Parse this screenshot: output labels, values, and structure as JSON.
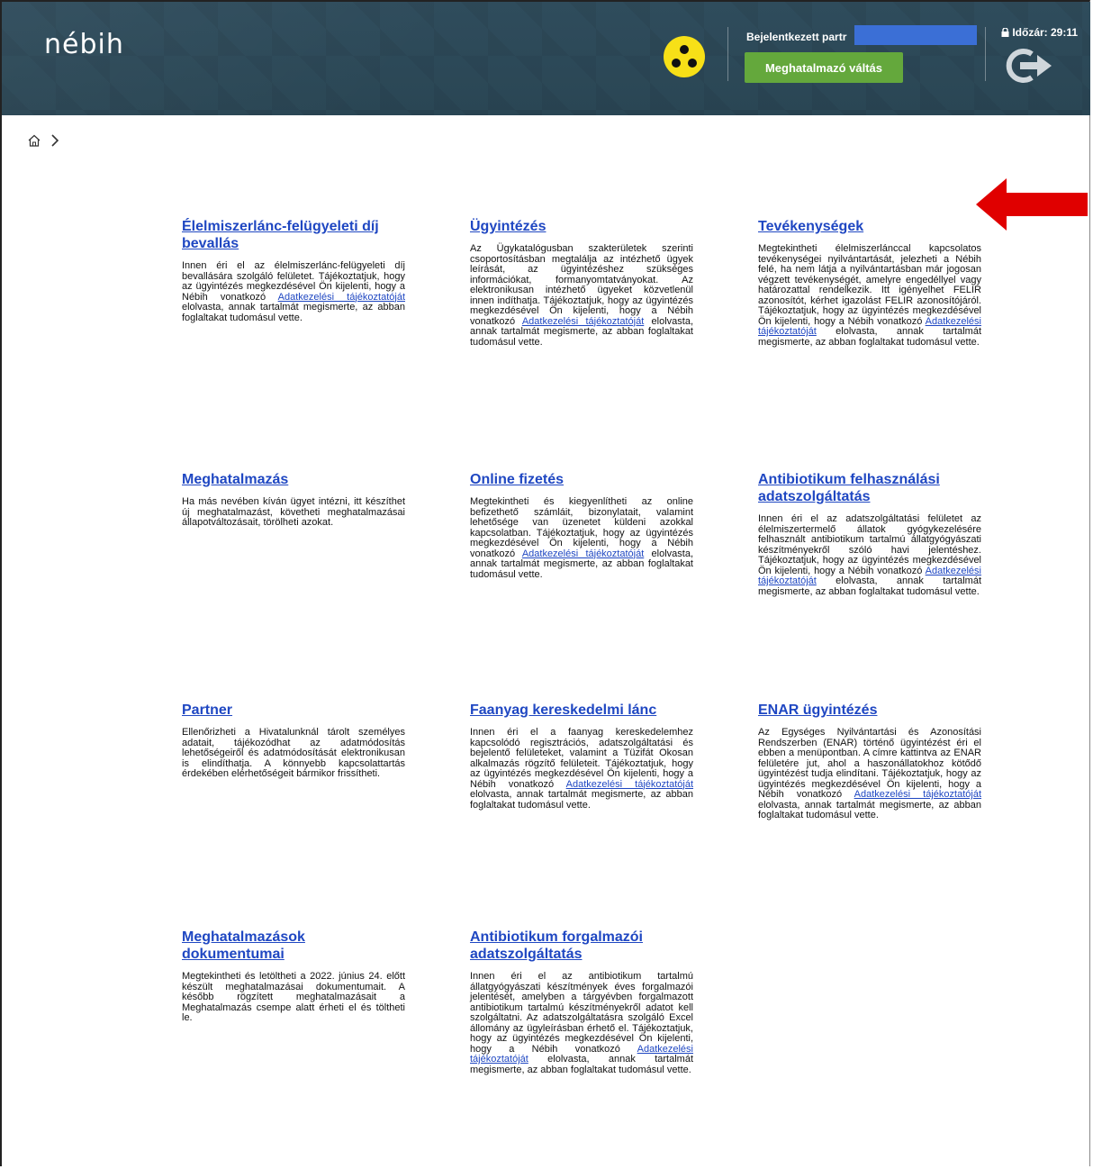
{
  "header": {
    "logo_text": "nébih",
    "logged_in_label": "Bejelentkezett partr",
    "switch_button": "Meghatalmazó váltás",
    "timer": "Időzár: 29:11"
  },
  "colors": {
    "header_bg": "#2f4c5c",
    "link": "#1f47c2",
    "switch_button_bg": "#64a83c",
    "accessibility_icon": "#f7e017",
    "arrow": "#e00000"
  },
  "icons": {
    "accessibility": "low-vision-icon",
    "logout": "logout-icon",
    "home": "home-icon",
    "breadcrumb_separator": "chevron-right-icon",
    "lock": "lock-icon"
  },
  "link_text": "Adatkezelési tájékoztatóját",
  "tiles": [
    {
      "title": "Élelmiszerlánc-felügyeleti díj bevallás",
      "pre": "Innen éri el az élelmiszerlánc-felügyeleti díj bevallására szolgáló felületet. Tájékoztatjuk, hogy az ügyintézés megkezdésével Ön kijelenti, hogy a Nébih vonatkozó ",
      "post": " elolvasta, annak tartalmát megismerte, az abban foglaltakat tudomásul vette."
    },
    {
      "title": "Ügyintézés",
      "pre": "Az Ügykatalógusban szakterületek szerinti csoportosításban megtalálja az intézhető ügyek leírását, az ügyintézéshez szükséges információkat, formanyomtatványokat. Az elektronikusan intézhető ügyeket közvetlenül innen indíthatja. Tájékoztatjuk, hogy az ügyintézés megkezdésével Ön kijelenti, hogy a Nébih vonatkozó ",
      "post": " elolvasta, annak tartalmát megismerte, az abban foglaltakat tudomásul vette."
    },
    {
      "title": "Tevékenységek",
      "pre": "Megtekintheti élelmiszerlánccal kapcsolatos tevékenységei nyilvántartását, jelezheti a Nébih felé, ha nem látja a nyilvántartásban már jogosan végzett tevékenységét, amelyre engedéllyel vagy határozattal rendelkezik. Itt igényelhet FELIR azonosítót, kérhet igazolást FELIR azonosítójáról. Tájékoztatjuk, hogy az ügyintézés megkezdésével Ön kijelenti, hogy a Nébih vonatkozó ",
      "post": " elolvasta, annak tartalmát megismerte, az abban foglaltakat tudomásul vette."
    },
    {
      "title": "Meghatalmazás",
      "pre": "Ha más nevében kíván ügyet intézni, itt készíthet új meghatalmazást, követheti meghatalmazásai állapotváltozásait, törölheti azokat.",
      "post": ""
    },
    {
      "title": "Online fizetés",
      "pre": "Megtekintheti és kiegyenlítheti az online befizethető számláit, bizonylatait, valamint lehetősége van üzenetet küldeni azokkal kapcsolatban. Tájékoztatjuk, hogy az ügyintézés megkezdésével Ön kijelenti, hogy a Nébih vonatkozó ",
      "post": " elolvasta, annak tartalmát megismerte, az abban foglaltakat tudomásul vette."
    },
    {
      "title": "Antibiotikum felhasználási adatszolgáltatás",
      "pre": "Innen éri el az adatszolgáltatási felületet az élelmiszertermelő állatok gyógykezelésére felhasznált antibiotikum tartalmú állatgyógyászati készítményekről szóló havi jelentéshez. Tájékoztatjuk, hogy az ügyintézés megkezdésével Ön kijelenti, hogy a Nébih vonatkozó ",
      "post": " elolvasta, annak tartalmát megismerte, az abban foglaltakat tudomásul vette."
    },
    {
      "title": "Partner",
      "pre": "Ellenőrizheti a Hivatalunknál tárolt személyes adatait, tájékozódhat az adatmódosítás lehetőségeiről és adatmódosítását elektronikusan is elindíthatja. A könnyebb kapcsolattartás érdekében elérhetőségeit bármikor frissítheti.",
      "post": ""
    },
    {
      "title": "Faanyag kereskedelmi lánc",
      "pre": "Innen éri el a faanyag kereskedelemhez kapcsolódó regisztrációs, adatszolgáltatási és bejelentő felületeket, valamint a Tüzifát Okosan alkalmazás rögzítő felületeit. Tájékoztatjuk, hogy az ügyintézés megkezdésével Ön kijelenti, hogy a Nébih vonatkozó ",
      "post": " elolvasta, annak tartalmát megismerte, az abban foglaltakat tudomásul vette."
    },
    {
      "title": "ENAR ügyintézés",
      "pre": "Az Egységes Nyilvántartási és Azonosítási Rendszerben (ENAR) történő ügyintézést éri el ebben a menüpontban. A címre kattintva az ENAR felületére jut, ahol a haszonállatokhoz kötődő ügyintézést tudja elindítani. Tájékoztatjuk, hogy az ügyintézés megkezdésével Ön kijelenti, hogy a Nébih vonatkozó ",
      "post": " elolvasta, annak tartalmát megismerte, az abban foglaltakat tudomásul vette."
    },
    {
      "title": "Meghatalmazások dokumentumai",
      "pre": "Megtekintheti és letöltheti a 2022. június 24. előtt készült meghatalmazásai dokumentumait. A később rögzített meghatalmazásait a Meghatalmazás csempe alatt érheti el és töltheti le.",
      "post": ""
    },
    {
      "title": "Antibiotikum forgalmazói adatszolgáltatás",
      "pre": "Innen éri el az antibiotikum tartalmú állatgyógyászati készítmények éves forgalmazói jelentését, amelyben a tárgyévben forgalmazott antibiotikum tartalmú készítményekről adatot kell szolgáltatni. Az adatszolgáltatásra szolgáló Excel állomány az ügyleírásban érhető el. Tájékoztatjuk, hogy az ügyintézés megkezdésével Ön kijelenti, hogy a Nébih vonatkozó ",
      "post": " elolvasta, annak tartalmát megismerte, az abban foglaltakat tudomásul vette."
    }
  ]
}
